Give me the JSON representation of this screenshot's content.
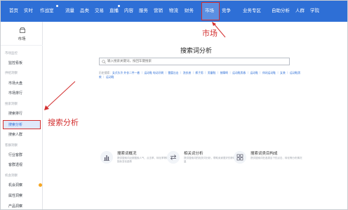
{
  "topnav": {
    "items": [
      "首页",
      "实时",
      "作战室",
      "流量",
      "品类",
      "交易",
      "直播",
      "内容",
      "服务",
      "营销",
      "物流",
      "财务",
      "市场",
      "竞争",
      "业务专区",
      "自助分析",
      "人群",
      "学院"
    ],
    "active_label": "市场"
  },
  "sidebar": {
    "title": "市场",
    "sections": [
      {
        "label": "市场监控",
        "items": [
          "监控看板"
        ]
      },
      {
        "label": "供给洞察",
        "items": [
          "市场大盘",
          "市场排行"
        ]
      },
      {
        "label": "搜索洞察",
        "items": [
          "搜索排行",
          "搜索分析",
          "搜索人群"
        ]
      },
      {
        "label": "客群洞察",
        "items": [
          "行业客群",
          "客群透视"
        ]
      },
      {
        "label": "机会洞察",
        "items": [
          "属性洞察",
          "产品洞察"
        ]
      }
    ],
    "ghost_item": "机会洞察"
  },
  "main": {
    "page_title": "搜索词分析",
    "search_placeholder": "输入搜索关键词，按回车键搜索",
    "hot_words_label": "历史搜索：",
    "hot_words_text": "女式头冷 外衣二件一套 ｜ 运动鞋 电动牙刷 ｜ 雷霆出击 ｜ 洗衣液 ｜ 裤子男 ｜ 男童鞋 ｜ 按摩椅 ｜ 运动鞋男春 ｜ 运动鞋 ｜ 休闲运动鞋 ｜ 女装 ｜ 运动鞋男款 ｜ 运动鞋",
    "cards": [
      {
        "title": "搜索词概况",
        "desc": "提供搜索词近期搜索人气、点击率、转化率等核心指标变化趋势"
      },
      {
        "title": "相关词分析",
        "desc": "提供搜索词的相关词分析，帮助卖家更好的获取流量"
      },
      {
        "title": "搜索词类目构成",
        "desc": "提供搜索词在各类目下的点击、转化等分布情况"
      }
    ]
  },
  "annotations": {
    "market_label": "市场",
    "search_analysis_label": "搜索分析",
    "color": "#d32f2f"
  },
  "colors": {
    "nav_blue": "#2e6fd6",
    "highlight_red": "#d32f2f",
    "selected_bg": "#dfe9fb"
  }
}
